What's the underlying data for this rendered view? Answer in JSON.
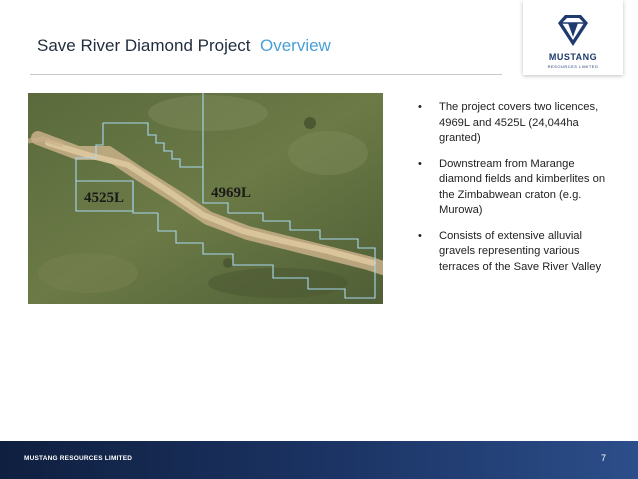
{
  "slide": {
    "title": "Save River Diamond Project",
    "title_accent": "Overview",
    "page_number": "7"
  },
  "logo": {
    "name": "MUSTANG",
    "subtitle": "RESOURCES LIMITED"
  },
  "map": {
    "licence_labels": [
      "4525L",
      "4969L"
    ]
  },
  "bullets": [
    "The project covers two licences, 4969L and 4525L (24,044ha granted)",
    "Downstream from Marange diamond fields and kimberlites on the Zimbabwean craton (e.g. Murowa)",
    "Consists of extensive alluvial gravels representing various terraces of the Save River Valley"
  ],
  "footer": {
    "company": "MUSTANG RESOURCES LIMITED"
  },
  "colors": {
    "title": "#1f2d3d",
    "accent": "#4a9fd8",
    "footer": "#1c3566",
    "licence_boundary": "#9fd2ee"
  }
}
